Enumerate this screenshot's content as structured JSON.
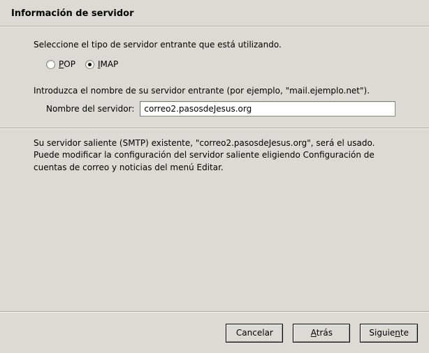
{
  "header": {
    "title": "Información de servidor"
  },
  "intro": "Seleccione el tipo de servidor entrante que está utilizando.",
  "radios": {
    "pop": {
      "prefix": "P",
      "rest": "OP",
      "checked": false
    },
    "imap": {
      "prefix": "I",
      "rest": "MAP",
      "checked": true
    }
  },
  "server_prompt": "Introduzca el nombre de su servidor entrante (por ejemplo, \"mail.ejemplo.net\").",
  "server_field": {
    "label": "Nombre del servidor:",
    "value": "correo2.pasosdeJesus.org"
  },
  "smtp_note": "Su servidor saliente (SMTP) existente, \"correo2.pasosdeJesus.org\", será el usado. Puede modificar la configuración del servidor saliente eligiendo Configuración de cuentas de correo y noticias del menú Editar.",
  "buttons": {
    "cancel": "Cancelar",
    "back_prefix": "A",
    "back_rest": "trás",
    "next_prefix": "Siguie",
    "next_under": "n",
    "next_rest": "te"
  }
}
